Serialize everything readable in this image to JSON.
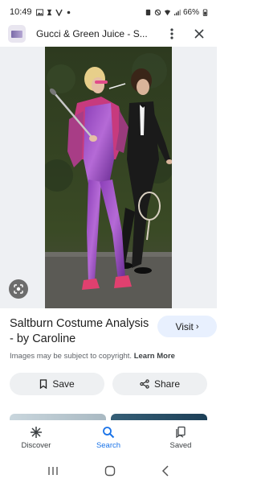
{
  "status_bar": {
    "time": "10:49",
    "battery": "66%"
  },
  "header": {
    "title": "Gucci & Green Juice - S..."
  },
  "result": {
    "title": "Saltburn Costume Analysis - by Caroline",
    "visit_label": "Visit",
    "copyright_text": "Images may be subject to copyright.",
    "learn_more": "Learn More"
  },
  "actions": {
    "save_label": "Save",
    "share_label": "Share"
  },
  "bottom_nav": {
    "discover": "Discover",
    "search": "Search",
    "saved": "Saved"
  },
  "colors": {
    "accent": "#1a73e8",
    "visit_bg": "#e8f0fe",
    "button_bg": "#eef0f2"
  },
  "icons": [
    "gallery-icon",
    "signal-icon",
    "battery-icon",
    "more-vert-icon",
    "close-icon",
    "google-lens-icon",
    "bookmark-icon",
    "share-icon",
    "discover-icon",
    "search-icon",
    "saved-icon"
  ]
}
